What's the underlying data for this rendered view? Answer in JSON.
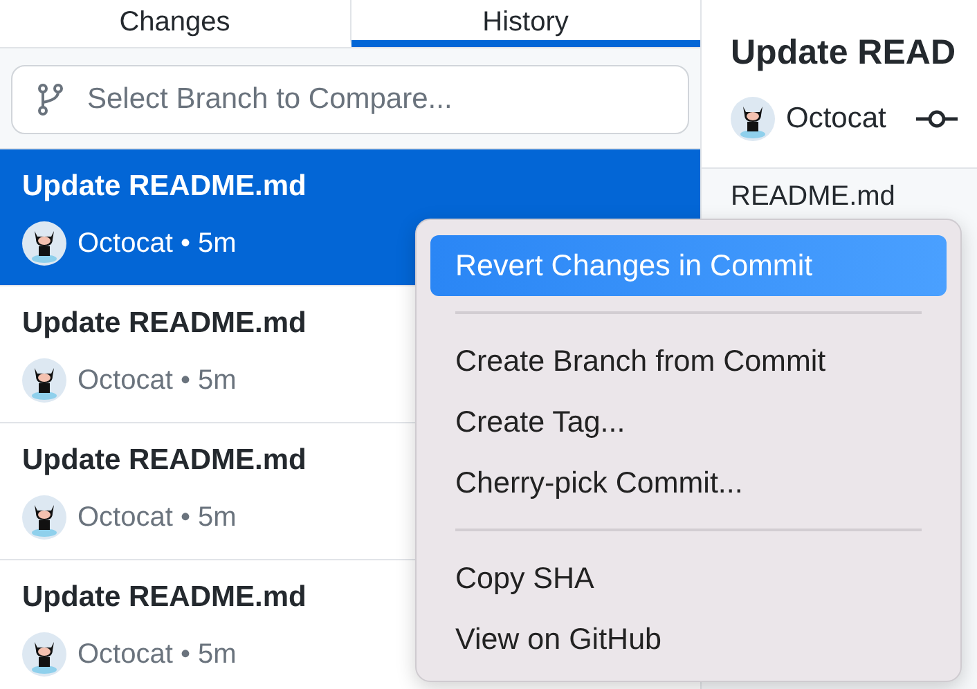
{
  "tabs": [
    {
      "label": "Changes",
      "selected": false
    },
    {
      "label": "History",
      "selected": true
    }
  ],
  "branch_select": {
    "placeholder": "Select Branch to Compare..."
  },
  "commits": [
    {
      "title": "Update README.md",
      "meta": "Octocat • 5m",
      "selected": true
    },
    {
      "title": "Update README.md",
      "meta": "Octocat • 5m",
      "selected": false
    },
    {
      "title": "Update README.md",
      "meta": "Octocat • 5m",
      "selected": false
    },
    {
      "title": "Update README.md",
      "meta": "Octocat • 5m",
      "selected": false
    }
  ],
  "commit_detail": {
    "title": "Update READ",
    "author": "Octocat",
    "files": [
      {
        "name": "README.md"
      }
    ]
  },
  "context_menu": {
    "groups": [
      [
        {
          "label": "Revert Changes in Commit",
          "selected": true
        }
      ],
      [
        {
          "label": "Create Branch from Commit",
          "selected": false
        },
        {
          "label": "Create Tag...",
          "selected": false
        },
        {
          "label": "Cherry-pick Commit...",
          "selected": false
        }
      ],
      [
        {
          "label": "Copy SHA",
          "selected": false
        },
        {
          "label": "View on GitHub",
          "selected": false
        }
      ]
    ]
  }
}
